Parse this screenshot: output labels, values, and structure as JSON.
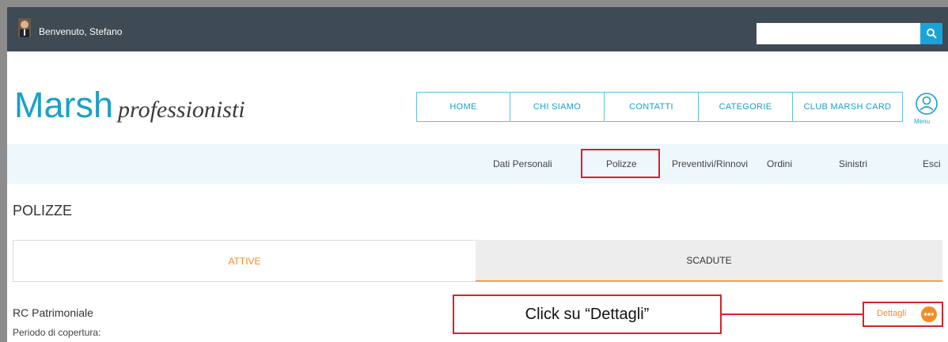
{
  "topbar": {
    "welcome": "Benvenuto, Stefano",
    "search_placeholder": "",
    "search_icon": "search-icon"
  },
  "logo": {
    "primary": "Marsh",
    "secondary": "professionisti"
  },
  "nav": {
    "items": [
      {
        "label": "HOME"
      },
      {
        "label": "CHI SIAMO"
      },
      {
        "label": "CONTATTI"
      },
      {
        "label": "CATEGORIE"
      },
      {
        "label": "CLUB MARSH CARD"
      }
    ],
    "menu_label": "Menu",
    "menu_icon": "user-circle-icon"
  },
  "subnav": {
    "items": [
      {
        "label": "Dati Personali"
      },
      {
        "label": "Polizze"
      },
      {
        "label": "Preventivi/Rinnovi"
      },
      {
        "label": "Ordini"
      },
      {
        "label": "Sinistri"
      },
      {
        "label": "Esci"
      }
    ],
    "selected": "Polizze"
  },
  "page": {
    "title": "POLIZZE",
    "tabs": [
      {
        "label": "ATTIVE",
        "active": true
      },
      {
        "label": "SCADUTE",
        "active": false
      }
    ]
  },
  "policy": {
    "name": "RC Patrimoniale",
    "period_label": "Periodo di copertura:",
    "details_label": "Dettagli",
    "details_icon": "more-dots-icon"
  },
  "callout": {
    "text": "Click su “Dettagli”"
  },
  "colors": {
    "topbar": "#3e4a54",
    "brand_blue": "#1b9fc8",
    "accent_orange": "#f28c28",
    "highlight_red": "#d9222a",
    "subnav_bg": "#eef7fc"
  }
}
